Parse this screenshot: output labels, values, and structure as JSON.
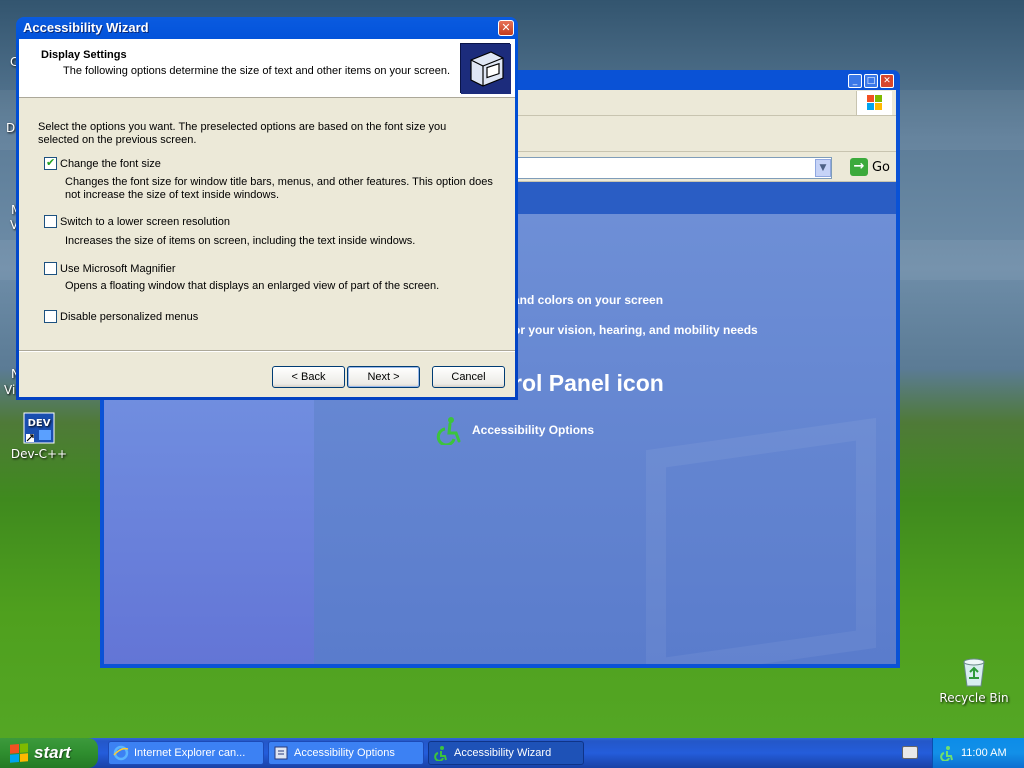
{
  "desktop": {
    "icons": [
      {
        "label": "Dev-C++",
        "icon": "dev-cpp-icon"
      },
      {
        "label": "Recycle Bin",
        "icon": "recycle-bin-icon"
      }
    ],
    "partial_labels": [
      "C",
      "D",
      "M",
      "V",
      "N",
      "Vi"
    ]
  },
  "control_panel": {
    "address_go_label": "Go",
    "task1": "and colors on your screen",
    "task2": "or your vision, hearing, and mobility needs",
    "heading": "rol Panel icon",
    "icon_item_label": "Accessibility Options"
  },
  "wizard": {
    "title": "Accessibility Wizard",
    "header_title": "Display Settings",
    "header_subtitle": "The following options determine the size of text and other items on your screen.",
    "intro": "Select the options you want.  The preselected options are based on the font size you selected on the previous screen.",
    "options": [
      {
        "label": "Change the font size",
        "checked": true,
        "desc": "Changes the font size for window title bars, menus, and other features.  This option does not increase the size of text inside windows."
      },
      {
        "label": "Switch to a lower screen resolution",
        "checked": false,
        "desc": "Increases the size of items on screen, including the text inside windows."
      },
      {
        "label": "Use Microsoft Magnifier",
        "checked": false,
        "desc": "Opens a floating window that displays an enlarged view of part of the screen."
      },
      {
        "label": "Disable personalized menus",
        "checked": false,
        "desc": ""
      }
    ],
    "buttons": {
      "back": "< Back",
      "next": "Next >",
      "cancel": "Cancel"
    }
  },
  "taskbar": {
    "start_label": "start",
    "tasks": [
      {
        "label": "Internet Explorer can...",
        "icon": "internet-explorer-icon",
        "active": false
      },
      {
        "label": "Accessibility Options",
        "icon": "accessibility-options-icon",
        "active": false
      },
      {
        "label": "Accessibility Wizard",
        "icon": "accessibility-wizard-icon",
        "active": true
      }
    ],
    "clock": "11:00 AM"
  },
  "colors": {
    "xp_blue": "#0a52d6",
    "dialog_face": "#ece9d8",
    "start_green": "#3c9a3c"
  }
}
